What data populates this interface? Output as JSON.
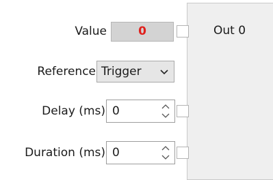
{
  "node": {
    "title": "Out 0"
  },
  "fields": {
    "value": {
      "label": "Value",
      "display": "0"
    },
    "reference": {
      "label": "Reference",
      "selected": "Trigger"
    },
    "delay": {
      "label": "Delay (ms)",
      "value": "0"
    },
    "duration": {
      "label": "Duration (ms)",
      "value": "0"
    }
  },
  "colors": {
    "value_text": "#e0201c",
    "node_bg": "#efefef"
  },
  "icons": {
    "dropdown": "chevron-down-icon",
    "spinner": "spinner-arrows-icon"
  }
}
